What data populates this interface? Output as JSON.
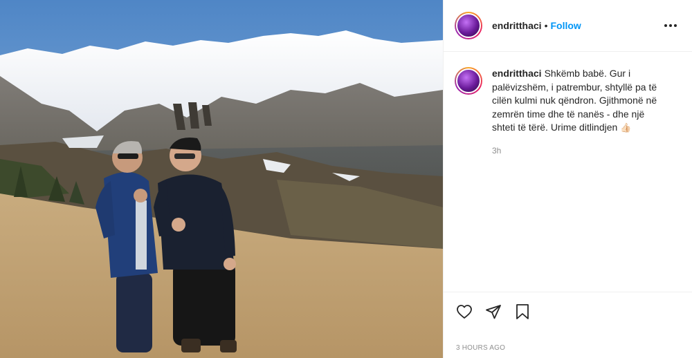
{
  "post": {
    "username": "endritthaci",
    "separator": "•",
    "follow_label": "Follow",
    "more_icon": "more-options-icon",
    "caption_username": "endritthaci",
    "caption_text": "Shkëmb babë. Gur i palëvizshëm, i patrembur, shtyllë pa të cilën kulmi nuk qëndron. Gjithmonë në zemrën time dhe të nanës - dhe një shteti të tërë. Urime ditlindjen",
    "caption_emoji": "👍🏻",
    "relative_time": "3h",
    "timestamp": "3 HOURS AGO"
  },
  "icons": {
    "like": "heart-icon",
    "share": "paper-plane-icon",
    "save": "bookmark-icon"
  },
  "colors": {
    "follow": "#0095f6",
    "text": "#262626",
    "muted": "#8e8e8e"
  }
}
